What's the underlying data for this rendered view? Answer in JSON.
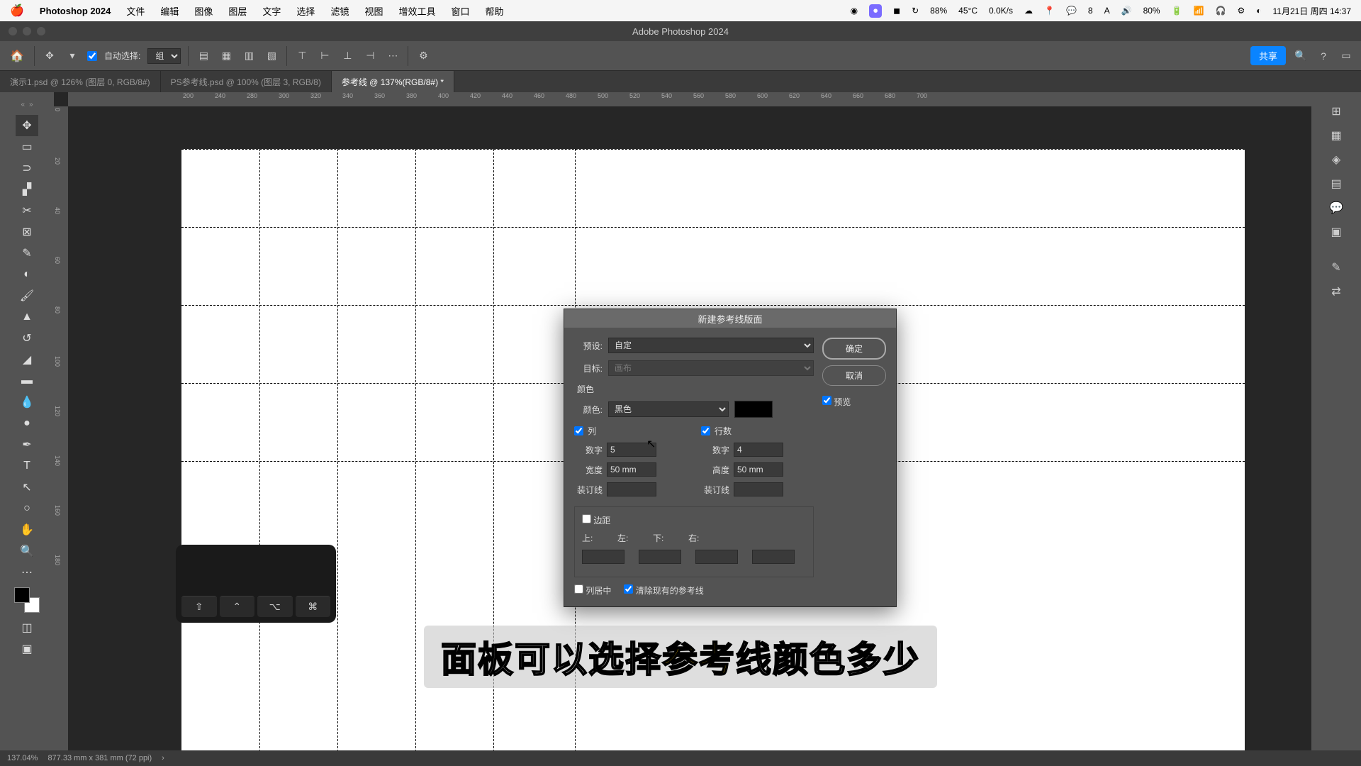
{
  "menubar": {
    "app": "Photoshop 2024",
    "items": [
      "文件",
      "编辑",
      "图像",
      "图层",
      "文字",
      "选择",
      "滤镜",
      "视图",
      "增效工具",
      "窗口",
      "帮助"
    ],
    "right": {
      "battery": "88%",
      "temp": "45°C",
      "cpu": "0.0K/s",
      "num": "8",
      "batt2": "80%",
      "clock": "11月21日 周四 14:37"
    }
  },
  "window_title": "Adobe Photoshop 2024",
  "options": {
    "auto_select": "自动选择:",
    "group": "组",
    "share": "共享"
  },
  "tabs": [
    {
      "label": "演示1.psd @ 126% (图层 0, RGB/8#)",
      "active": false
    },
    {
      "label": "PS参考线.psd @ 100% (图层 3, RGB/8)",
      "active": false
    },
    {
      "label": "参考线 @ 137%(RGB/8#) *",
      "active": true
    }
  ],
  "ruler": {
    "marks": [
      "200",
      "240",
      "280",
      "300",
      "320",
      "340",
      "360",
      "380",
      "400",
      "420",
      "440",
      "460",
      "480",
      "500",
      "520",
      "540",
      "560",
      "580",
      "600",
      "620",
      "640",
      "660",
      "680",
      "700"
    ],
    "vmarks": [
      "0",
      "20",
      "40",
      "60",
      "80",
      "100",
      "120",
      "140",
      "160",
      "180"
    ]
  },
  "dialog": {
    "title": "新建参考线版面",
    "preset_lbl": "预设:",
    "preset": "自定",
    "target_lbl": "目标:",
    "target": "画布",
    "color_hdr": "颜色",
    "color_lbl": "颜色:",
    "color": "黑色",
    "col_hdr": "列",
    "row_hdr": "行数",
    "count_lbl": "数字",
    "col_count": "5",
    "row_count": "4",
    "width_lbl": "宽度",
    "height_lbl": "高度",
    "col_width": "50 mm",
    "row_height": "50 mm",
    "gutter_lbl": "装订线",
    "col_gutter": "",
    "row_gutter": "",
    "margin_hdr": "边距",
    "top": "上:",
    "left": "左:",
    "bottom": "下:",
    "right_m": "右:",
    "center": "列居中",
    "clear": "清除现有的参考线",
    "ok": "确定",
    "cancel": "取消",
    "preview": "预览"
  },
  "status": {
    "zoom": "137.04%",
    "info": "877.33 mm x 381 mm (72 ppi)"
  },
  "subtitle": {
    "p1": "面板可以选择",
    "hl": "参考",
    "p2": "线颜色多少"
  },
  "icons": {
    "apple": "apple-icon"
  }
}
